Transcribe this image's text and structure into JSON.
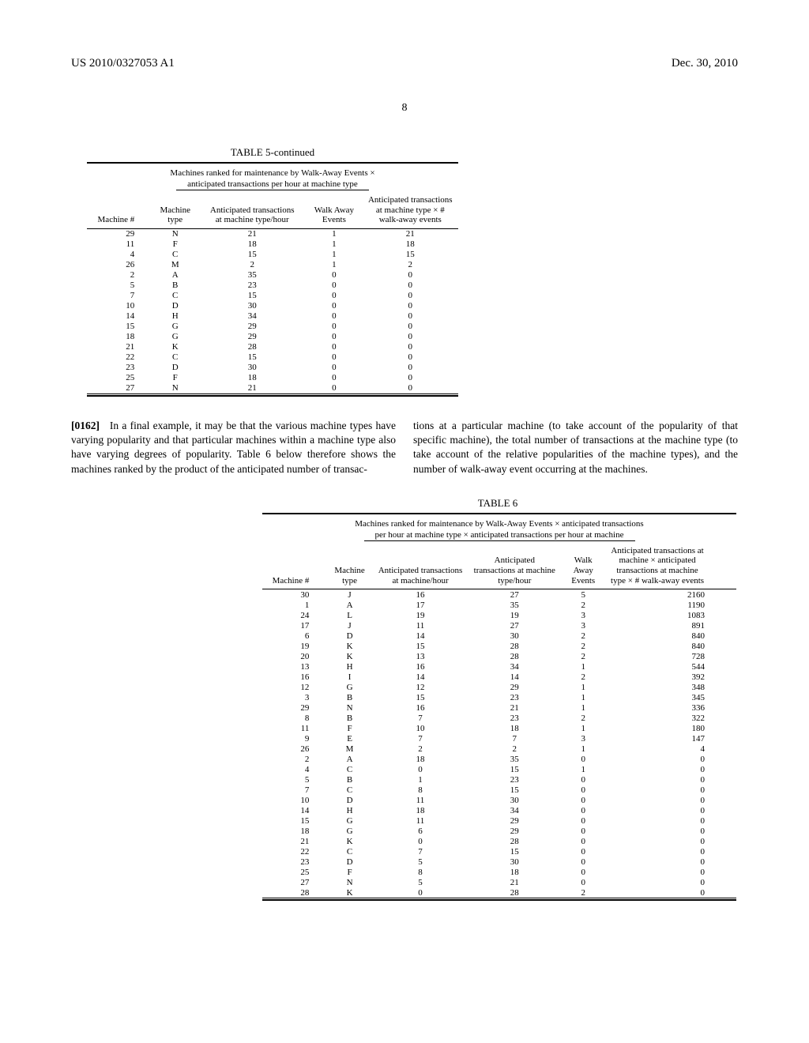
{
  "header": {
    "left": "US 2010/0327053 A1",
    "right": "Dec. 30, 2010",
    "page": "8"
  },
  "table5": {
    "caption": "TABLE 5-continued",
    "subcaption1": "Machines ranked for maintenance by Walk-Away Events ×",
    "subcaption2": "anticipated transactions per hour at machine type",
    "columns": {
      "c1": "Machine #",
      "c2": "Machine type",
      "c3": "Anticipated transactions at machine type/hour",
      "c4": "Walk Away Events",
      "c5": "Anticipated transactions at machine type × # walk-away events"
    },
    "rows": [
      {
        "m": "29",
        "t": "N",
        "a": "21",
        "w": "1",
        "r": "21"
      },
      {
        "m": "11",
        "t": "F",
        "a": "18",
        "w": "1",
        "r": "18"
      },
      {
        "m": "4",
        "t": "C",
        "a": "15",
        "w": "1",
        "r": "15"
      },
      {
        "m": "26",
        "t": "M",
        "a": "2",
        "w": "1",
        "r": "2"
      },
      {
        "m": "2",
        "t": "A",
        "a": "35",
        "w": "0",
        "r": "0"
      },
      {
        "m": "5",
        "t": "B",
        "a": "23",
        "w": "0",
        "r": "0"
      },
      {
        "m": "7",
        "t": "C",
        "a": "15",
        "w": "0",
        "r": "0"
      },
      {
        "m": "10",
        "t": "D",
        "a": "30",
        "w": "0",
        "r": "0"
      },
      {
        "m": "14",
        "t": "H",
        "a": "34",
        "w": "0",
        "r": "0"
      },
      {
        "m": "15",
        "t": "G",
        "a": "29",
        "w": "0",
        "r": "0"
      },
      {
        "m": "18",
        "t": "G",
        "a": "29",
        "w": "0",
        "r": "0"
      },
      {
        "m": "21",
        "t": "K",
        "a": "28",
        "w": "0",
        "r": "0"
      },
      {
        "m": "22",
        "t": "C",
        "a": "15",
        "w": "0",
        "r": "0"
      },
      {
        "m": "23",
        "t": "D",
        "a": "30",
        "w": "0",
        "r": "0"
      },
      {
        "m": "25",
        "t": "F",
        "a": "18",
        "w": "0",
        "r": "0"
      },
      {
        "m": "27",
        "t": "N",
        "a": "21",
        "w": "0",
        "r": "0"
      }
    ]
  },
  "paragraph": {
    "num": "[0162]",
    "left": "In a final example, it may be that the various machine types have varying popularity and that particular machines within a machine type also have varying degrees of popularity. Table 6 below therefore shows the machines ranked by the product of the anticipated number of transac-",
    "right": "tions at a particular machine (to take account of the popularity of that specific machine), the total number of transactions at the machine type (to take account of the relative popularities of the machine types), and the number of walk-away event occurring at the machines."
  },
  "table6": {
    "caption": "TABLE 6",
    "subcaption1": "Machines ranked for maintenance by Walk-Away Events × anticipated transactions",
    "subcaption2": "per hour at machine type × anticipated transactions per hour at machine",
    "columns": {
      "c1": "Machine #",
      "c2": "Machine type",
      "c3": "Anticipated transactions at machine/hour",
      "c4": "Anticipated transactions at machine type/hour",
      "c5": "Walk Away Events",
      "c6": "Anticipated transactions at machine × anticipated transactions at machine type × # walk-away events"
    },
    "rows": [
      {
        "m": "30",
        "t": "J",
        "a": "16",
        "b": "27",
        "w": "5",
        "r": "2160"
      },
      {
        "m": "1",
        "t": "A",
        "a": "17",
        "b": "35",
        "w": "2",
        "r": "1190"
      },
      {
        "m": "24",
        "t": "L",
        "a": "19",
        "b": "19",
        "w": "3",
        "r": "1083"
      },
      {
        "m": "17",
        "t": "J",
        "a": "11",
        "b": "27",
        "w": "3",
        "r": "891"
      },
      {
        "m": "6",
        "t": "D",
        "a": "14",
        "b": "30",
        "w": "2",
        "r": "840"
      },
      {
        "m": "19",
        "t": "K",
        "a": "15",
        "b": "28",
        "w": "2",
        "r": "840"
      },
      {
        "m": "20",
        "t": "K",
        "a": "13",
        "b": "28",
        "w": "2",
        "r": "728"
      },
      {
        "m": "13",
        "t": "H",
        "a": "16",
        "b": "34",
        "w": "1",
        "r": "544"
      },
      {
        "m": "16",
        "t": "I",
        "a": "14",
        "b": "14",
        "w": "2",
        "r": "392"
      },
      {
        "m": "12",
        "t": "G",
        "a": "12",
        "b": "29",
        "w": "1",
        "r": "348"
      },
      {
        "m": "3",
        "t": "B",
        "a": "15",
        "b": "23",
        "w": "1",
        "r": "345"
      },
      {
        "m": "29",
        "t": "N",
        "a": "16",
        "b": "21",
        "w": "1",
        "r": "336"
      },
      {
        "m": "8",
        "t": "B",
        "a": "7",
        "b": "23",
        "w": "2",
        "r": "322"
      },
      {
        "m": "11",
        "t": "F",
        "a": "10",
        "b": "18",
        "w": "1",
        "r": "180"
      },
      {
        "m": "9",
        "t": "E",
        "a": "7",
        "b": "7",
        "w": "3",
        "r": "147"
      },
      {
        "m": "26",
        "t": "M",
        "a": "2",
        "b": "2",
        "w": "1",
        "r": "4"
      },
      {
        "m": "2",
        "t": "A",
        "a": "18",
        "b": "35",
        "w": "0",
        "r": "0"
      },
      {
        "m": "4",
        "t": "C",
        "a": "0",
        "b": "15",
        "w": "1",
        "r": "0"
      },
      {
        "m": "5",
        "t": "B",
        "a": "1",
        "b": "23",
        "w": "0",
        "r": "0"
      },
      {
        "m": "7",
        "t": "C",
        "a": "8",
        "b": "15",
        "w": "0",
        "r": "0"
      },
      {
        "m": "10",
        "t": "D",
        "a": "11",
        "b": "30",
        "w": "0",
        "r": "0"
      },
      {
        "m": "14",
        "t": "H",
        "a": "18",
        "b": "34",
        "w": "0",
        "r": "0"
      },
      {
        "m": "15",
        "t": "G",
        "a": "11",
        "b": "29",
        "w": "0",
        "r": "0"
      },
      {
        "m": "18",
        "t": "G",
        "a": "6",
        "b": "29",
        "w": "0",
        "r": "0"
      },
      {
        "m": "21",
        "t": "K",
        "a": "0",
        "b": "28",
        "w": "0",
        "r": "0"
      },
      {
        "m": "22",
        "t": "C",
        "a": "7",
        "b": "15",
        "w": "0",
        "r": "0"
      },
      {
        "m": "23",
        "t": "D",
        "a": "5",
        "b": "30",
        "w": "0",
        "r": "0"
      },
      {
        "m": "25",
        "t": "F",
        "a": "8",
        "b": "18",
        "w": "0",
        "r": "0"
      },
      {
        "m": "27",
        "t": "N",
        "a": "5",
        "b": "21",
        "w": "0",
        "r": "0"
      },
      {
        "m": "28",
        "t": "K",
        "a": "0",
        "b": "28",
        "w": "2",
        "r": "0"
      }
    ]
  }
}
